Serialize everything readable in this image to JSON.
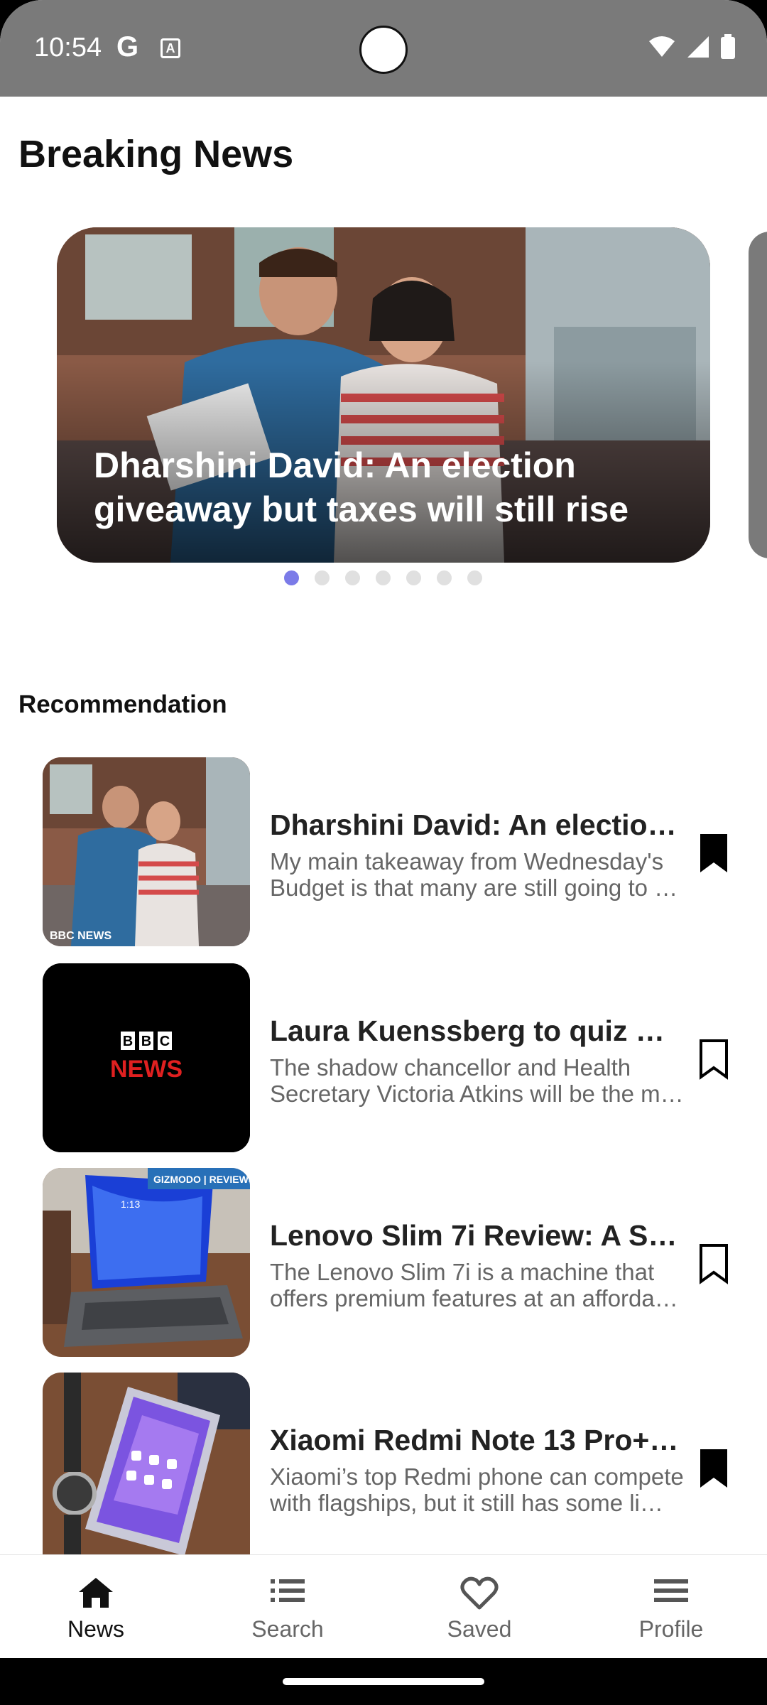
{
  "status_bar": {
    "time": "10:54",
    "g_icon": "google-icon",
    "a_icon": "font-accessibility-icon"
  },
  "page": {
    "title": "Breaking News"
  },
  "carousel": {
    "title": "Dharshini David: An election giveaway but taxes will still rise",
    "total_dots": 7,
    "active_dot": 1
  },
  "recommendation": {
    "title": "Recommendation",
    "items": [
      {
        "title": "Dharshini David: An electio…",
        "desc_line1": "My main takeaway from Wednesday's",
        "desc_line2": "Budget is that many are still going to …",
        "bookmarked": true,
        "thumb_caption": "BBC NEWS"
      },
      {
        "title": "Laura Kuenssberg to quiz L…",
        "desc_line1": "The shadow chancellor and Health",
        "desc_line2": "Secretary Victoria Atkins will be the m…",
        "bookmarked": false,
        "logo_top": "BBC",
        "logo_bottom": "NEWS"
      },
      {
        "title": "Lenovo Slim 7i Review: A S…",
        "desc_line1": "The Lenovo Slim 7i is a machine that",
        "desc_line2": "offers premium features at an afforda…",
        "bookmarked": false,
        "thumb_caption": "GIZMODO | REVIEWS",
        "screen_time": "1:13"
      },
      {
        "title": "Xiaomi Redmi Note 13 Pro+ …",
        "desc_line1": "Xiaomi’s top Redmi phone can compete",
        "desc_line2": "with flagships, but it still has some li…",
        "bookmarked": true
      }
    ]
  },
  "bottom_nav": {
    "items": [
      {
        "label": "News",
        "icon": "home-icon",
        "active": true
      },
      {
        "label": "Search",
        "icon": "list-icon",
        "active": false
      },
      {
        "label": "Saved",
        "icon": "heart-icon",
        "active": false
      },
      {
        "label": "Profile",
        "icon": "menu-icon",
        "active": false
      }
    ]
  },
  "colors": {
    "status_bar": "#7a7a7a",
    "dot_active": "#7b7be8",
    "dot_inactive": "#e0e0e0",
    "text_primary": "#111111",
    "text_secondary": "#666666"
  }
}
